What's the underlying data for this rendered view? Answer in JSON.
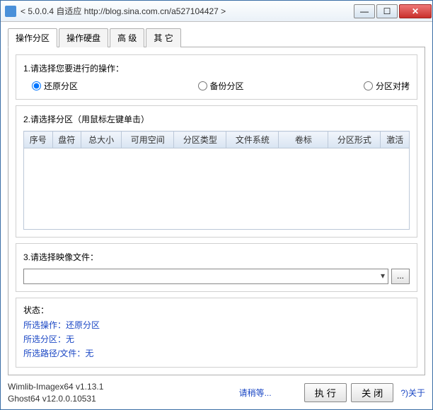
{
  "window": {
    "title": "< 5.0.0.4 自适应 http://blog.sina.com.cn/a527104427 >"
  },
  "tabs": [
    {
      "label": "操作分区"
    },
    {
      "label": "操作硬盘"
    },
    {
      "label": "高 级"
    },
    {
      "label": "其 它"
    }
  ],
  "group1": {
    "title": "1.请选择您要进行的操作：",
    "options": [
      {
        "label": "还原分区",
        "checked": true
      },
      {
        "label": "备份分区",
        "checked": false
      },
      {
        "label": "分区对拷",
        "checked": false
      }
    ]
  },
  "group2": {
    "title": "2.请选择分区（用鼠标左键单击）",
    "columns": [
      "序号",
      "盘符",
      "总大小",
      "可用空间",
      "分区类型",
      "文件系统",
      "卷标",
      "分区形式",
      "激活"
    ]
  },
  "group3": {
    "title": "3.请选择映像文件：",
    "combo_value": "",
    "browse": "..."
  },
  "status": {
    "title": "状态：",
    "lines": [
      "所选操作：还原分区",
      "所选分区：无",
      "所选路径/文件：无"
    ]
  },
  "footer": {
    "ver1": "Wimlib-Imagex64 v1.13.1",
    "ver2": "Ghost64 v12.0.0.10531",
    "wait": "请稍等...",
    "execute": "执  行",
    "close": "关  闭",
    "about": "?)关于"
  }
}
